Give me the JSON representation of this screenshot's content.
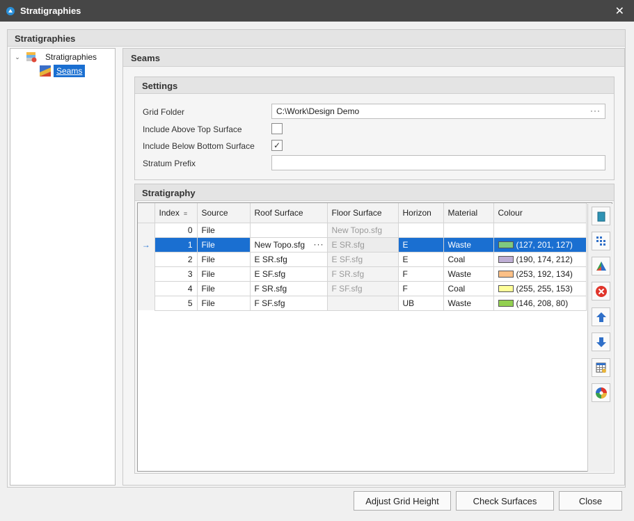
{
  "window": {
    "title": "Stratigraphies",
    "close_glyph": "✕"
  },
  "panel": {
    "title": "Stratigraphies"
  },
  "tree": {
    "root_label": "Stratigraphies",
    "child_label": "Seams"
  },
  "seams": {
    "title": "Seams"
  },
  "settings": {
    "title": "Settings",
    "grid_folder_label": "Grid Folder",
    "grid_folder_value": "C:\\Work\\Design Demo",
    "include_above_label": "Include Above Top Surface",
    "include_above_checked": false,
    "include_below_label": "Include Below Bottom Surface",
    "include_below_checked": true,
    "stratum_prefix_label": "Stratum Prefix",
    "stratum_prefix_value": ""
  },
  "stratigraphy": {
    "title": "Stratigraphy",
    "columns": [
      "Index",
      "Source",
      "Roof Surface",
      "Floor Surface",
      "Horizon",
      "Material",
      "Colour"
    ],
    "selected_row": 1,
    "rows": [
      {
        "index": "0",
        "source": "File",
        "roof": "",
        "floor": "New Topo.sfg",
        "horizon": "",
        "material": "",
        "colour_text": "",
        "colour_hex": ""
      },
      {
        "index": "1",
        "source": "File",
        "roof": "New Topo.sfg",
        "floor": "E SR.sfg",
        "horizon": "E",
        "material": "Waste",
        "colour_text": "(127, 201, 127)",
        "colour_hex": "#7fc97f"
      },
      {
        "index": "2",
        "source": "File",
        "roof": "E SR.sfg",
        "floor": "E SF.sfg",
        "horizon": "E",
        "material": "Coal",
        "colour_text": "(190, 174, 212)",
        "colour_hex": "#beaed4"
      },
      {
        "index": "3",
        "source": "File",
        "roof": "E SF.sfg",
        "floor": "F SR.sfg",
        "horizon": "F",
        "material": "Waste",
        "colour_text": "(253, 192, 134)",
        "colour_hex": "#fdc086"
      },
      {
        "index": "4",
        "source": "File",
        "roof": "F SR.sfg",
        "floor": "F SF.sfg",
        "horizon": "F",
        "material": "Coal",
        "colour_text": "(255, 255, 153)",
        "colour_hex": "#ffff99"
      },
      {
        "index": "5",
        "source": "File",
        "roof": "F SF.sfg",
        "floor": "",
        "horizon": "UB",
        "material": "Waste",
        "colour_text": "(146, 208, 80)",
        "colour_hex": "#92d050"
      }
    ],
    "toolbar": [
      "add-icon",
      "grid-icon",
      "surface-icon",
      "delete-icon",
      "move-up-icon",
      "move-down-icon",
      "table-settings-icon",
      "colour-wheel-icon"
    ]
  },
  "buttons": {
    "adjust_grid_height": "Adjust Grid Height",
    "check_surfaces": "Check Surfaces",
    "close": "Close"
  },
  "colors": {
    "selection": "#1a6fd1",
    "titlebar": "#464646"
  }
}
